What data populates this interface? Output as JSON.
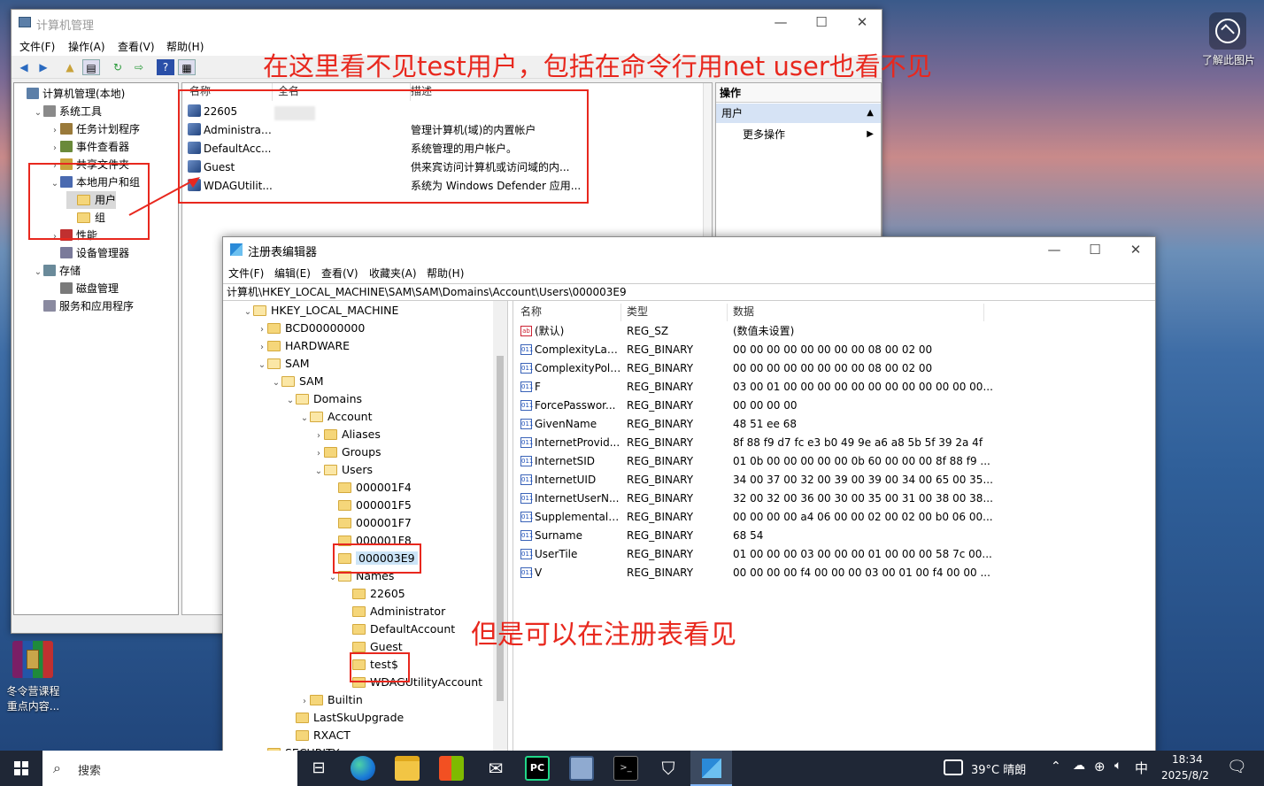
{
  "desktop": {
    "icon_label_right": "了解此图片",
    "icon_label_left_line1": "冬令营课程",
    "icon_label_left_line2": "重点内容..."
  },
  "compmgmt": {
    "title": "计算机管理",
    "menu": [
      "文件(F)",
      "操作(A)",
      "查看(V)",
      "帮助(H)"
    ],
    "tree": [
      {
        "label": "计算机管理(本地)",
        "level": 0
      },
      {
        "label": "系统工具",
        "level": 1
      },
      {
        "label": "任务计划程序",
        "level": 2
      },
      {
        "label": "事件查看器",
        "level": 2
      },
      {
        "label": "共享文件夹",
        "level": 2
      },
      {
        "label": "本地用户和组",
        "level": 2
      },
      {
        "label": "用户",
        "level": 3
      },
      {
        "label": "组",
        "level": 3
      },
      {
        "label": "性能",
        "level": 2
      },
      {
        "label": "设备管理器",
        "level": 2
      },
      {
        "label": "存储",
        "level": 1
      },
      {
        "label": "磁盘管理",
        "level": 2
      },
      {
        "label": "服务和应用程序",
        "level": 1
      }
    ],
    "columns": [
      "名称",
      "全名",
      "描述"
    ],
    "users": [
      {
        "name": "22605",
        "fullname": "",
        "desc": ""
      },
      {
        "name": "Administrat...",
        "fullname": "",
        "desc": "管理计算机(域)的内置帐户"
      },
      {
        "name": "DefaultAcc...",
        "fullname": "",
        "desc": "系统管理的用户帐户。"
      },
      {
        "name": "Guest",
        "fullname": "",
        "desc": "供来宾访问计算机或访问域的内..."
      },
      {
        "name": "WDAGUtilit...",
        "fullname": "",
        "desc": "系统为 Windows Defender 应用..."
      }
    ],
    "actions": {
      "header": "操作",
      "section": "用户",
      "more": "更多操作"
    }
  },
  "regedit": {
    "title": "注册表编辑器",
    "menu": [
      "文件(F)",
      "编辑(E)",
      "查看(V)",
      "收藏夹(A)",
      "帮助(H)"
    ],
    "address": "计算机\\HKEY_LOCAL_MACHINE\\SAM\\SAM\\Domains\\Account\\Users\\000003E9",
    "tree": [
      {
        "label": "HKEY_LOCAL_MACHINE",
        "level": 0,
        "exp": "v"
      },
      {
        "label": "BCD00000000",
        "level": 1,
        "exp": ">"
      },
      {
        "label": "HARDWARE",
        "level": 1,
        "exp": ">"
      },
      {
        "label": "SAM",
        "level": 1,
        "exp": "v"
      },
      {
        "label": "SAM",
        "level": 2,
        "exp": "v"
      },
      {
        "label": "Domains",
        "level": 3,
        "exp": "v"
      },
      {
        "label": "Account",
        "level": 4,
        "exp": "v"
      },
      {
        "label": "Aliases",
        "level": 5,
        "exp": ">"
      },
      {
        "label": "Groups",
        "level": 5,
        "exp": ">"
      },
      {
        "label": "Users",
        "level": 5,
        "exp": "v"
      },
      {
        "label": "000001F4",
        "level": 6,
        "exp": ""
      },
      {
        "label": "000001F5",
        "level": 6,
        "exp": ""
      },
      {
        "label": "000001F7",
        "level": 6,
        "exp": ""
      },
      {
        "label": "000001F8",
        "level": 6,
        "exp": ""
      },
      {
        "label": "000003E9",
        "level": 6,
        "exp": ""
      },
      {
        "label": "Names",
        "level": 6,
        "exp": "v"
      },
      {
        "label": "22605",
        "level": 7,
        "exp": ""
      },
      {
        "label": "Administrator",
        "level": 7,
        "exp": ""
      },
      {
        "label": "DefaultAccount",
        "level": 7,
        "exp": ""
      },
      {
        "label": "Guest",
        "level": 7,
        "exp": ""
      },
      {
        "label": "test$",
        "level": 7,
        "exp": ""
      },
      {
        "label": "WDAGUtilityAccount",
        "level": 7,
        "exp": ""
      },
      {
        "label": "Builtin",
        "level": 4,
        "exp": ">"
      },
      {
        "label": "LastSkuUpgrade",
        "level": 3,
        "exp": ""
      },
      {
        "label": "RXACT",
        "level": 3,
        "exp": ""
      },
      {
        "label": "SECURITY",
        "level": 1,
        "exp": ">"
      }
    ],
    "columns": [
      "名称",
      "类型",
      "数据"
    ],
    "values": [
      {
        "name": "(默认)",
        "type": "REG_SZ",
        "data": "(数值未设置)",
        "icon": "ab"
      },
      {
        "name": "ComplexityLast...",
        "type": "REG_BINARY",
        "data": "00 00 00 00 00 00 00 00 08 00 02 00",
        "icon": "bin"
      },
      {
        "name": "ComplexityPoli...",
        "type": "REG_BINARY",
        "data": "00 00 00 00 00 00 00 00 08 00 02 00",
        "icon": "bin"
      },
      {
        "name": "F",
        "type": "REG_BINARY",
        "data": "03 00 01 00 00 00 00 00 00 00 00 00 00 00 00...",
        "icon": "bin"
      },
      {
        "name": "ForcePasswor...",
        "type": "REG_BINARY",
        "data": "00 00 00 00",
        "icon": "bin"
      },
      {
        "name": "GivenName",
        "type": "REG_BINARY",
        "data": "48 51 ee 68",
        "icon": "bin"
      },
      {
        "name": "InternetProvid...",
        "type": "REG_BINARY",
        "data": "8f 88 f9 d7 fc e3 b0 49 9e a6 a8 5b 5f 39 2a 4f",
        "icon": "bin"
      },
      {
        "name": "InternetSID",
        "type": "REG_BINARY",
        "data": "01 0b 00 00 00 00 00 0b 60 00 00 00 8f 88 f9 ...",
        "icon": "bin"
      },
      {
        "name": "InternetUID",
        "type": "REG_BINARY",
        "data": "34 00 37 00 32 00 39 00 39 00 34 00 65 00 35...",
        "icon": "bin"
      },
      {
        "name": "InternetUserN...",
        "type": "REG_BINARY",
        "data": "32 00 32 00 36 00 30 00 35 00 31 00 38 00 38...",
        "icon": "bin"
      },
      {
        "name": "SupplementalC...",
        "type": "REG_BINARY",
        "data": "00 00 00 00 a4 06 00 00 02 00 02 00 b0 06 00...",
        "icon": "bin"
      },
      {
        "name": "Surname",
        "type": "REG_BINARY",
        "data": "68 54",
        "icon": "bin"
      },
      {
        "name": "UserTile",
        "type": "REG_BINARY",
        "data": "01 00 00 00 03 00 00 00 01 00 00 00 58 7c 00...",
        "icon": "bin"
      },
      {
        "name": "V",
        "type": "REG_BINARY",
        "data": "00 00 00 00 f4 00 00 00 03 00 01 00 f4 00 00 ...",
        "icon": "bin"
      }
    ]
  },
  "annotations": {
    "top": "在这里看不见test用户，包括在命令行用net user也看不见",
    "bottom": "但是可以在注册表看见"
  },
  "taskbar": {
    "search_placeholder": "搜索",
    "weather": "39°C 晴朗",
    "ime": "中",
    "time": "18:34",
    "date": "2025/8/2"
  }
}
